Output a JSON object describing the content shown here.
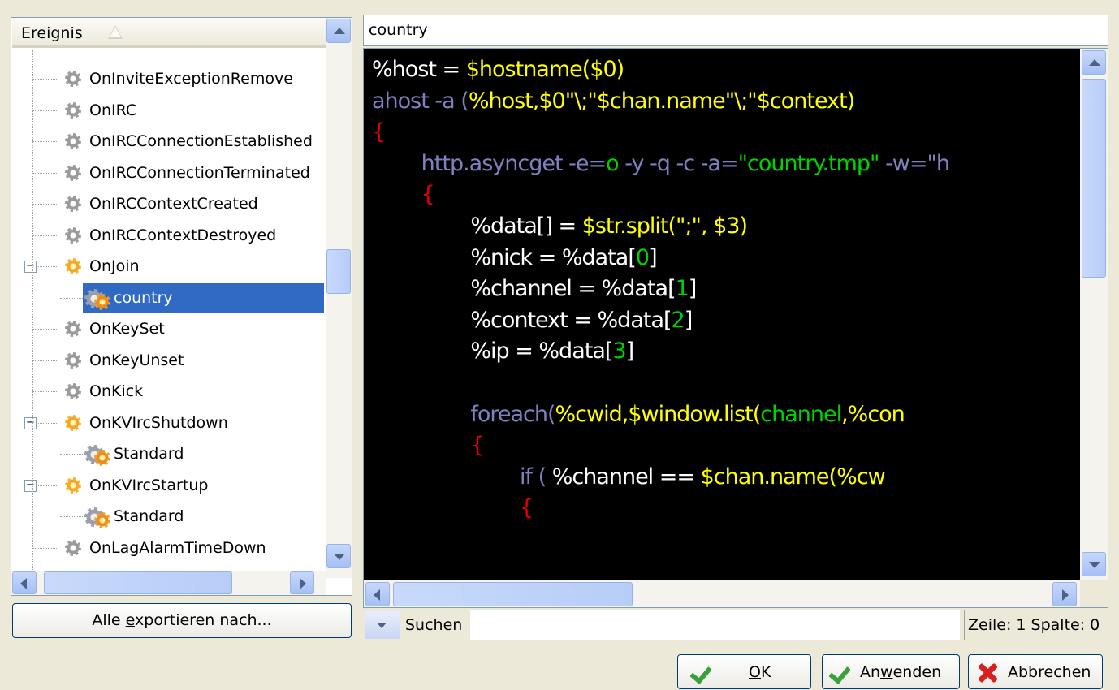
{
  "tree": {
    "header": "Ereignis",
    "rows": [
      {
        "label": "OnInviteExceptionRemove",
        "level": 1,
        "icon": "gear-grey"
      },
      {
        "label": "OnIRC",
        "level": 1,
        "icon": "gear-grey"
      },
      {
        "label": "OnIRCConnectionEstablished",
        "level": 1,
        "icon": "gear-grey"
      },
      {
        "label": "OnIRCConnectionTerminated",
        "level": 1,
        "icon": "gear-grey"
      },
      {
        "label": "OnIRCContextCreated",
        "level": 1,
        "icon": "gear-grey"
      },
      {
        "label": "OnIRCContextDestroyed",
        "level": 1,
        "icon": "gear-grey"
      },
      {
        "label": "OnJoin",
        "level": 1,
        "icon": "gear-orange",
        "expanded": true
      },
      {
        "label": "country",
        "level": 2,
        "icon": "script",
        "selected": true
      },
      {
        "label": "OnKeySet",
        "level": 1,
        "icon": "gear-grey"
      },
      {
        "label": "OnKeyUnset",
        "level": 1,
        "icon": "gear-grey"
      },
      {
        "label": "OnKick",
        "level": 1,
        "icon": "gear-grey"
      },
      {
        "label": "OnKVIrcShutdown",
        "level": 1,
        "icon": "gear-orange",
        "expanded": true
      },
      {
        "label": "Standard",
        "level": 2,
        "icon": "script"
      },
      {
        "label": "OnKVIrcStartup",
        "level": 1,
        "icon": "gear-orange",
        "expanded": true
      },
      {
        "label": "Standard",
        "level": 2,
        "icon": "script"
      },
      {
        "label": "OnLagAlarmTimeDown",
        "level": 1,
        "icon": "gear-grey"
      }
    ],
    "expander_symbol": "−"
  },
  "export_button": {
    "pre": "Alle ",
    "underlined": "e",
    "post": "xportieren nach..."
  },
  "editor": {
    "title": "country",
    "lines": [
      [
        [
          "%host = ",
          "var"
        ],
        [
          "$hostname",
          "fn"
        ],
        [
          "($0)",
          "fn"
        ]
      ],
      [
        [
          "ahost -a (",
          "kw"
        ],
        [
          "%host,",
          "fn"
        ],
        [
          "$0\"\\;\"$chan.name\"\\;\"$context)",
          "fn"
        ]
      ],
      [
        [
          "{",
          "red"
        ]
      ],
      [
        [
          "        http.asyncget -e=",
          "kw"
        ],
        [
          "o",
          "str"
        ],
        [
          " -y -q -c -a=",
          "kw"
        ],
        [
          "\"country.tmp\"",
          "str"
        ],
        [
          " -w=\"h",
          "kw"
        ]
      ],
      [
        [
          "        {",
          "red"
        ]
      ],
      [
        [
          "                %data[] = ",
          "var"
        ],
        [
          "$str.split(\";\", $3)",
          "fn"
        ]
      ],
      [
        [
          "                %nick = %data[",
          "var"
        ],
        [
          "0",
          "num"
        ],
        [
          "]",
          "var"
        ]
      ],
      [
        [
          "                %channel = %data[",
          "var"
        ],
        [
          "1",
          "num"
        ],
        [
          "]",
          "var"
        ]
      ],
      [
        [
          "                %context = %data[",
          "var"
        ],
        [
          "2",
          "num"
        ],
        [
          "]",
          "var"
        ]
      ],
      [
        [
          "                %ip = %data[",
          "var"
        ],
        [
          "3",
          "num"
        ],
        [
          "]",
          "var"
        ]
      ],
      [
        [
          "",
          "var"
        ]
      ],
      [
        [
          "                foreach(",
          "kw"
        ],
        [
          "%cwid,",
          "fn"
        ],
        [
          "$window.list(",
          "fn"
        ],
        [
          "channel",
          "str"
        ],
        [
          ",%con",
          "fn"
        ]
      ],
      [
        [
          "                {",
          "red"
        ]
      ],
      [
        [
          "                        if ( ",
          "kw"
        ],
        [
          "%channel == ",
          "var"
        ],
        [
          "$chan.name(%cw",
          "fn"
        ]
      ],
      [
        [
          "                        {",
          "red"
        ]
      ]
    ]
  },
  "search": {
    "label": "Suchen",
    "value": "",
    "position": "Zeile: 1 Spalte: 0"
  },
  "buttons": {
    "ok": {
      "underlined": "O",
      "post": "K"
    },
    "apply": {
      "pre": "An",
      "underlined": "w",
      "post": "enden"
    },
    "cancel": {
      "label": "Abbrechen"
    }
  },
  "colors": {
    "var": "#ffffff",
    "fn": "#ffff00",
    "str": "#00d200",
    "kw": "#8080c0",
    "red": "#e00000",
    "num": "#00d200",
    "selection": "#316ac5"
  }
}
